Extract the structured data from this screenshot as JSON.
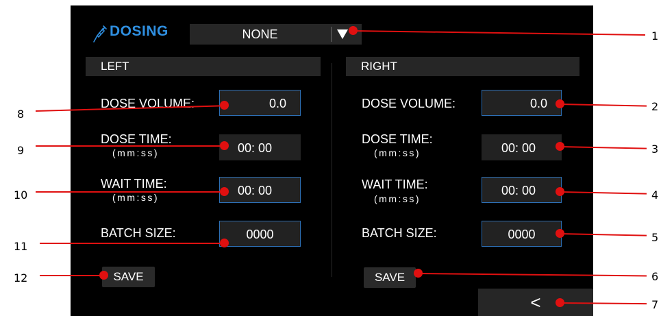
{
  "header": {
    "title": "DOSING",
    "title_icon": "syringe-icon",
    "mode_dropdown": {
      "selected": "NONE",
      "arrow_icon": "triangle-down-icon"
    }
  },
  "left": {
    "header": "LEFT",
    "dose_volume": {
      "label": "DOSE VOLUME:",
      "value": "0.0"
    },
    "dose_time": {
      "label": "DOSE TIME:",
      "sublabel": "(mm:ss)",
      "value": "00: 00"
    },
    "wait_time": {
      "label": "WAIT TIME:",
      "sublabel": "(mm:ss)",
      "value": "00: 00"
    },
    "batch_size": {
      "label": "BATCH SIZE:",
      "value": "0000"
    },
    "save_label": "SAVE"
  },
  "right": {
    "header": "RIGHT",
    "dose_volume": {
      "label": "DOSE VOLUME:",
      "value": "0.0"
    },
    "dose_time": {
      "label": "DOSE TIME:",
      "sublabel": "(mm:ss)",
      "value": "00: 00"
    },
    "wait_time": {
      "label": "WAIT TIME:",
      "sublabel": "(mm:ss)",
      "value": "00: 00"
    },
    "batch_size": {
      "label": "BATCH SIZE:",
      "value": "0000"
    },
    "save_label": "SAVE"
  },
  "back_button": {
    "label": "<"
  },
  "callouts": {
    "c1": "1",
    "c2": "2",
    "c3": "3",
    "c4": "4",
    "c5": "5",
    "c6": "6",
    "c7": "7",
    "c8": "8",
    "c9": "9",
    "c10": "10",
    "c11": "11",
    "c12": "12"
  },
  "colors": {
    "accent": "#2f8fe0",
    "field_border": "#2d6fb5",
    "callout": "#e01010",
    "screen_bg": "#000000"
  }
}
